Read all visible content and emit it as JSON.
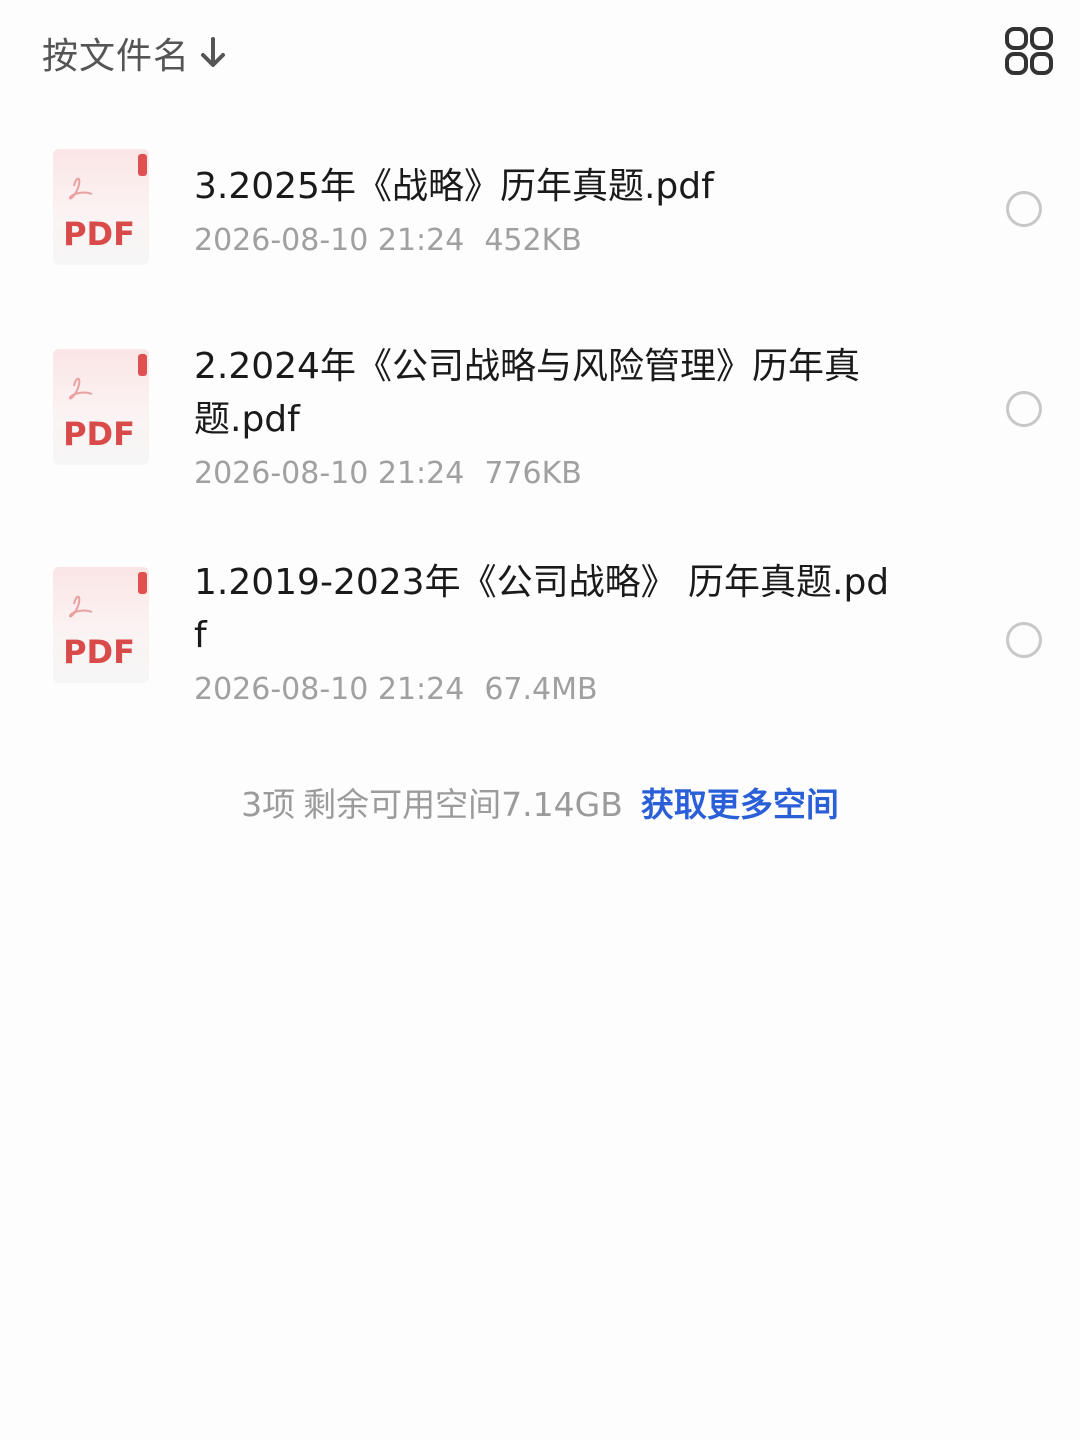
{
  "toolbar": {
    "sort_label": "按文件名",
    "sort_icon": "arrow-down-icon",
    "view_icon": "grid-view-icon"
  },
  "files": [
    {
      "icon_label": "PDF",
      "name": "3.2025年《战略》历年真题.pdf",
      "date": "2026-08-10 21:24",
      "size": "452KB"
    },
    {
      "icon_label": "PDF",
      "name": "2.2024年《公司战略与风险管理》历年真题.pdf",
      "date": "2026-08-10 21:24",
      "size": "776KB"
    },
    {
      "icon_label": "PDF",
      "name": "1.2019-2023年《公司战略》 历年真题.pdf",
      "date": "2026-08-10 21:24",
      "size": "67.4MB"
    }
  ],
  "footer": {
    "count": "3项",
    "space": "剩余可用空间7.14GB",
    "link": "获取更多空间"
  },
  "colors": {
    "pdf_red": "#d94a4a",
    "link_blue": "#2a5fd8",
    "meta_gray": "#a0a0a0"
  }
}
